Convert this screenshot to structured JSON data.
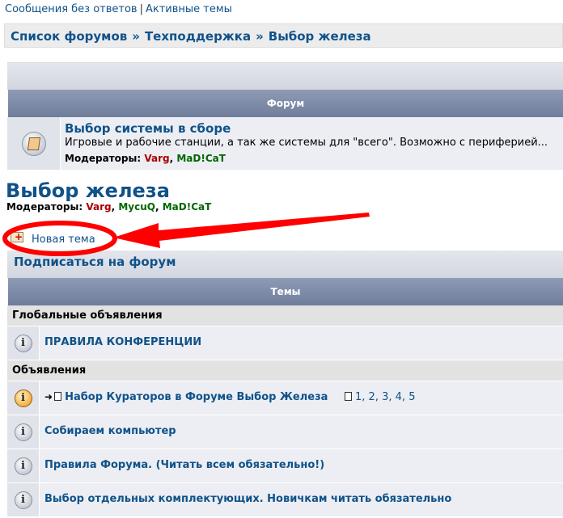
{
  "top_links": {
    "unanswered": "Сообщения без ответов",
    "separator": "|",
    "active": "Активные темы"
  },
  "breadcrumb": {
    "items": [
      "Список форумов",
      "Техподдержка",
      "Выбор железа"
    ],
    "separator": "»"
  },
  "forum_table": {
    "header": "Форум",
    "rows": [
      {
        "title": "Выбор системы в сборе",
        "description": "Игровые и рабочие станции, а так же системы для \"всего\". Возможно с периферией...",
        "moderators_label": "Модераторы:",
        "moderators": [
          {
            "name": "Varg",
            "color": "#aa0000"
          },
          {
            "name": "MaD!CaT",
            "color": "#006600"
          }
        ]
      }
    ]
  },
  "page": {
    "title": "Выбор железа",
    "moderators_label": "Модераторы:",
    "moderators": [
      {
        "name": "Varg",
        "color": "#aa0000"
      },
      {
        "name": "MycuQ",
        "color": "#006600"
      },
      {
        "name": "MaD!CaT",
        "color": "#006600"
      }
    ],
    "new_topic": "Новая тема",
    "subscribe": "Подписаться на форум"
  },
  "topics_table": {
    "header": "Темы",
    "sections": [
      {
        "label": "Глобальные объявления",
        "topics": [
          {
            "title": "ПРАВИЛА КОНФЕРЕНЦИИ",
            "icon": "info-icon"
          }
        ]
      },
      {
        "label": "Объявления",
        "topics": [
          {
            "title": "Набор Кураторов в Форуме Выбор Железа",
            "icon": "announce-icon",
            "moved": "➜",
            "pages": [
              "1",
              "2",
              "3",
              "4",
              "5"
            ]
          },
          {
            "title": "Собираем компьютер",
            "icon": "info-icon"
          },
          {
            "title": "Правила Форума. (Читать всем обязательно!)",
            "icon": "info-icon"
          },
          {
            "title": "Выбор отдельных комплектующих. Новичкам читать обязательно",
            "icon": "info-icon"
          }
        ]
      }
    ]
  },
  "colors": {
    "link": "#105289",
    "header_bar": "#7d89a6",
    "annotation": "#ff0000"
  }
}
